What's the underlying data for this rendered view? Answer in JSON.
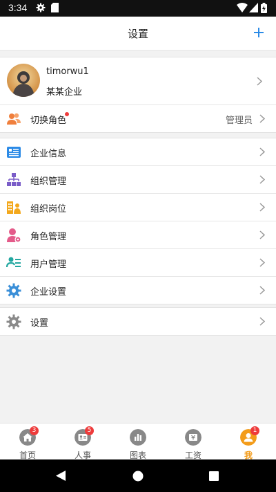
{
  "status_bar": {
    "time": "3:34"
  },
  "header": {
    "title": "设置"
  },
  "profile": {
    "username": "timorwu1",
    "company": "某某企业"
  },
  "role": {
    "label": "切换角色",
    "value": "管理员"
  },
  "menu": [
    {
      "label": "企业信息",
      "icon": "company-info-icon"
    },
    {
      "label": "组织管理",
      "icon": "org-management-icon"
    },
    {
      "label": "组织岗位",
      "icon": "org-position-icon"
    },
    {
      "label": "角色管理",
      "icon": "role-management-icon"
    },
    {
      "label": "用户管理",
      "icon": "user-management-icon"
    },
    {
      "label": "企业设置",
      "icon": "company-settings-icon"
    }
  ],
  "settings": {
    "label": "设置"
  },
  "tabs": [
    {
      "label": "首页",
      "badge": "3",
      "color": "#888888"
    },
    {
      "label": "人事",
      "badge": "5",
      "color": "#888888"
    },
    {
      "label": "图表",
      "badge": "",
      "color": "#888888"
    },
    {
      "label": "工资",
      "badge": "",
      "color": "#888888"
    },
    {
      "label": "我",
      "badge": "1",
      "color": "#f39c1a"
    }
  ],
  "colors": {
    "accent": "#2b8ae6",
    "active_tab": "#f39c1a",
    "badge": "#ee3b3b"
  }
}
